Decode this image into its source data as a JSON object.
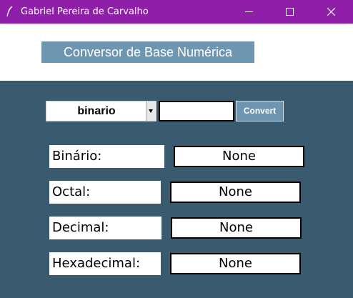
{
  "window": {
    "title": "Gabriel Pereira de Carvalho",
    "controls": {
      "minimize": "—",
      "maximize": "☐",
      "close": "✕"
    }
  },
  "app": {
    "heading": "Conversor de Base Numérica"
  },
  "converter": {
    "base_selected": "binario",
    "input_value": "",
    "convert_label": "Convert"
  },
  "results": [
    {
      "label": "Binário:",
      "value": "None"
    },
    {
      "label": "Octal:",
      "value": "None"
    },
    {
      "label": "Decimal:",
      "value": "None"
    },
    {
      "label": "Hexadecimal:",
      "value": "None"
    }
  ],
  "colors": {
    "titlebar": "#8f1fa8",
    "panel_bg": "#3a5a70",
    "accent": "#6f96b0"
  }
}
